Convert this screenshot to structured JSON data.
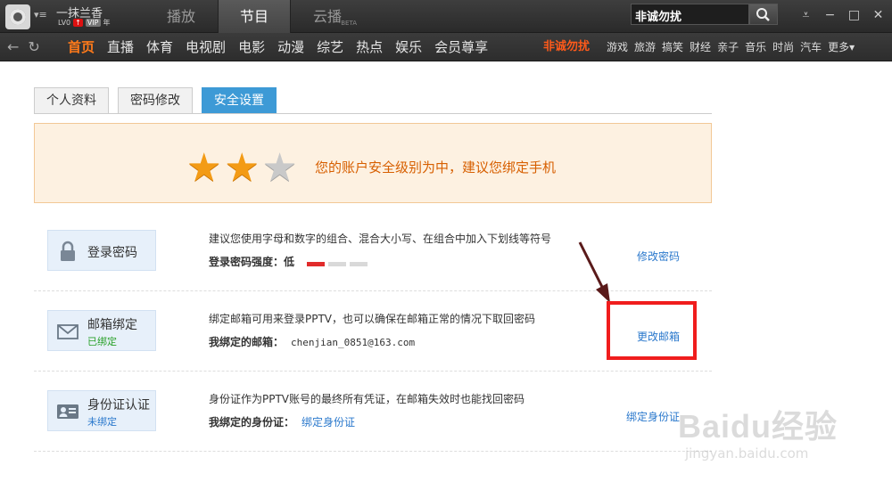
{
  "titlebar": {
    "username": "一抹兰香",
    "level": "LV0",
    "vip": "VIP",
    "vip_suffix": "年",
    "tabs": [
      {
        "label": "播放"
      },
      {
        "label": "节目"
      },
      {
        "label": "云播",
        "tag": "BETA"
      }
    ],
    "search_value": "非诚勿扰"
  },
  "navbar": {
    "main_items": [
      "首页",
      "直播",
      "体育",
      "电视剧",
      "电影",
      "动漫",
      "综艺",
      "热点",
      "娱乐",
      "会员尊享"
    ],
    "promo": "非诚勿扰",
    "small_items": [
      "游戏",
      "旅游",
      "搞笑",
      "财经",
      "亲子",
      "音乐",
      "时尚",
      "汽车",
      "更多▾"
    ]
  },
  "subtabs": [
    "个人资料",
    "密码修改",
    "安全设置"
  ],
  "banner": {
    "stars_on": 2,
    "stars_total": 3,
    "text": "您的账户安全级别为中，建议您绑定手机"
  },
  "rows": {
    "password": {
      "title": "登录密码",
      "desc": "建议您使用字母和数字的组合、混合大小写、在组合中加入下划线等符号",
      "strength_label": "登录密码强度：",
      "strength_value": "低",
      "strength_level": 1,
      "action": "修改密码"
    },
    "email": {
      "title": "邮箱绑定",
      "status": "已绑定",
      "desc": "绑定邮箱可用来登录PPTV，也可以确保在邮箱正常的情况下取回密码",
      "sub_label": "我绑定的邮箱：",
      "sub_value": "chenjian_0851@163.com",
      "action": "更改邮箱"
    },
    "idcard": {
      "title": "身份证认证",
      "status": "未绑定",
      "desc": "身份证作为PPTV账号的最终所有凭证，在邮箱失效时也能找回密码",
      "sub_label": "我绑定的身份证：",
      "sub_link": "绑定身份证",
      "action": "绑定身份证"
    }
  },
  "watermark": {
    "brand": "Baidu经验",
    "url": "jingyan.baidu.com"
  },
  "colors": {
    "accent_orange": "#ff7a1a",
    "active_tab_blue": "#3d9ad6",
    "link_blue": "#2a78cc",
    "highlight_red": "#f01d1d"
  }
}
